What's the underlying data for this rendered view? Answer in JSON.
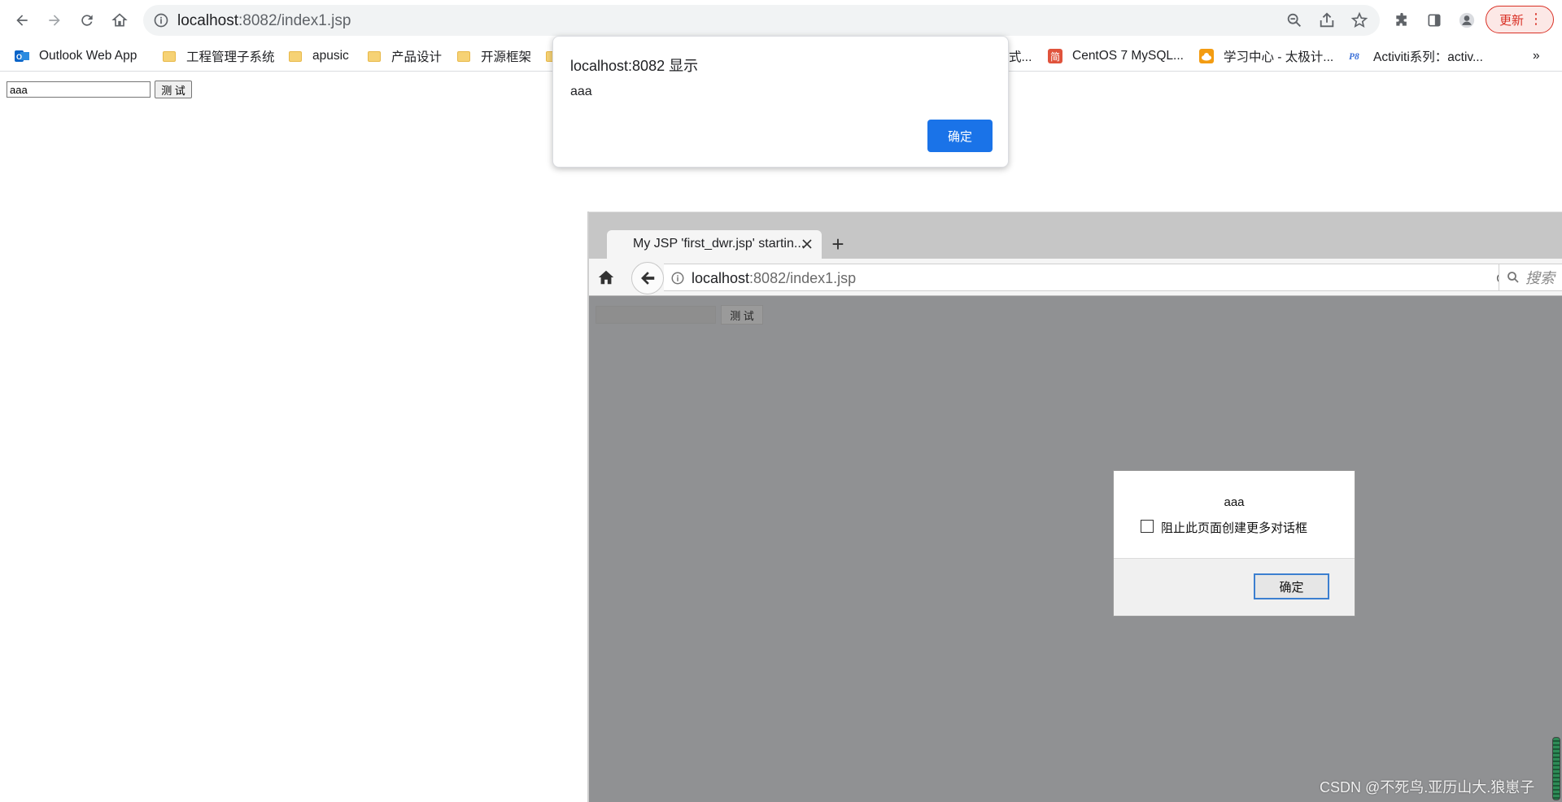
{
  "chrome": {
    "url_host": "localhost",
    "url_rest": ":8082/index1.jsp",
    "update_label": "更新",
    "more_label": "⋮"
  },
  "bookmarks": {
    "items": [
      {
        "label": "Outlook Web App",
        "icon": "outlook-icon"
      },
      {
        "label": "工程管理子系统",
        "icon": "folder-icon"
      },
      {
        "label": "apusic",
        "icon": "folder-icon"
      },
      {
        "label": "产品设计",
        "icon": "folder-icon"
      },
      {
        "label": "开源框架",
        "icon": "folder-icon"
      },
      {
        "label": "式...",
        "icon": "folder-icon"
      },
      {
        "label": "CentOS 7 MySQL...",
        "icon": "jian-icon"
      },
      {
        "label": "学习中心 - 太极计...",
        "icon": "cloud-icon"
      },
      {
        "label": "Activiti系列：activ...",
        "icon": "p8-icon"
      }
    ],
    "overflow": "»"
  },
  "page": {
    "input_value": "aaa",
    "button_label": "测 试"
  },
  "chrome_alert": {
    "title": "localhost:8082 显示",
    "message": "aaa",
    "ok_label": "确定",
    "ok_color": "#1a73e8"
  },
  "firefox": {
    "tab_title": "My JSP 'first_dwr.jsp' startin...",
    "newtab": "+",
    "url_host": "localhost",
    "url_rest": ":8082/index1.jsp",
    "search_placeholder": "搜索",
    "page_button_label": "测 试",
    "dialog": {
      "message": "aaa",
      "checkbox_label": "阻止此页面创建更多对话框",
      "ok_label": "确定"
    }
  },
  "watermark": "CSDN @不死鸟.亚历山大.狼崽子"
}
